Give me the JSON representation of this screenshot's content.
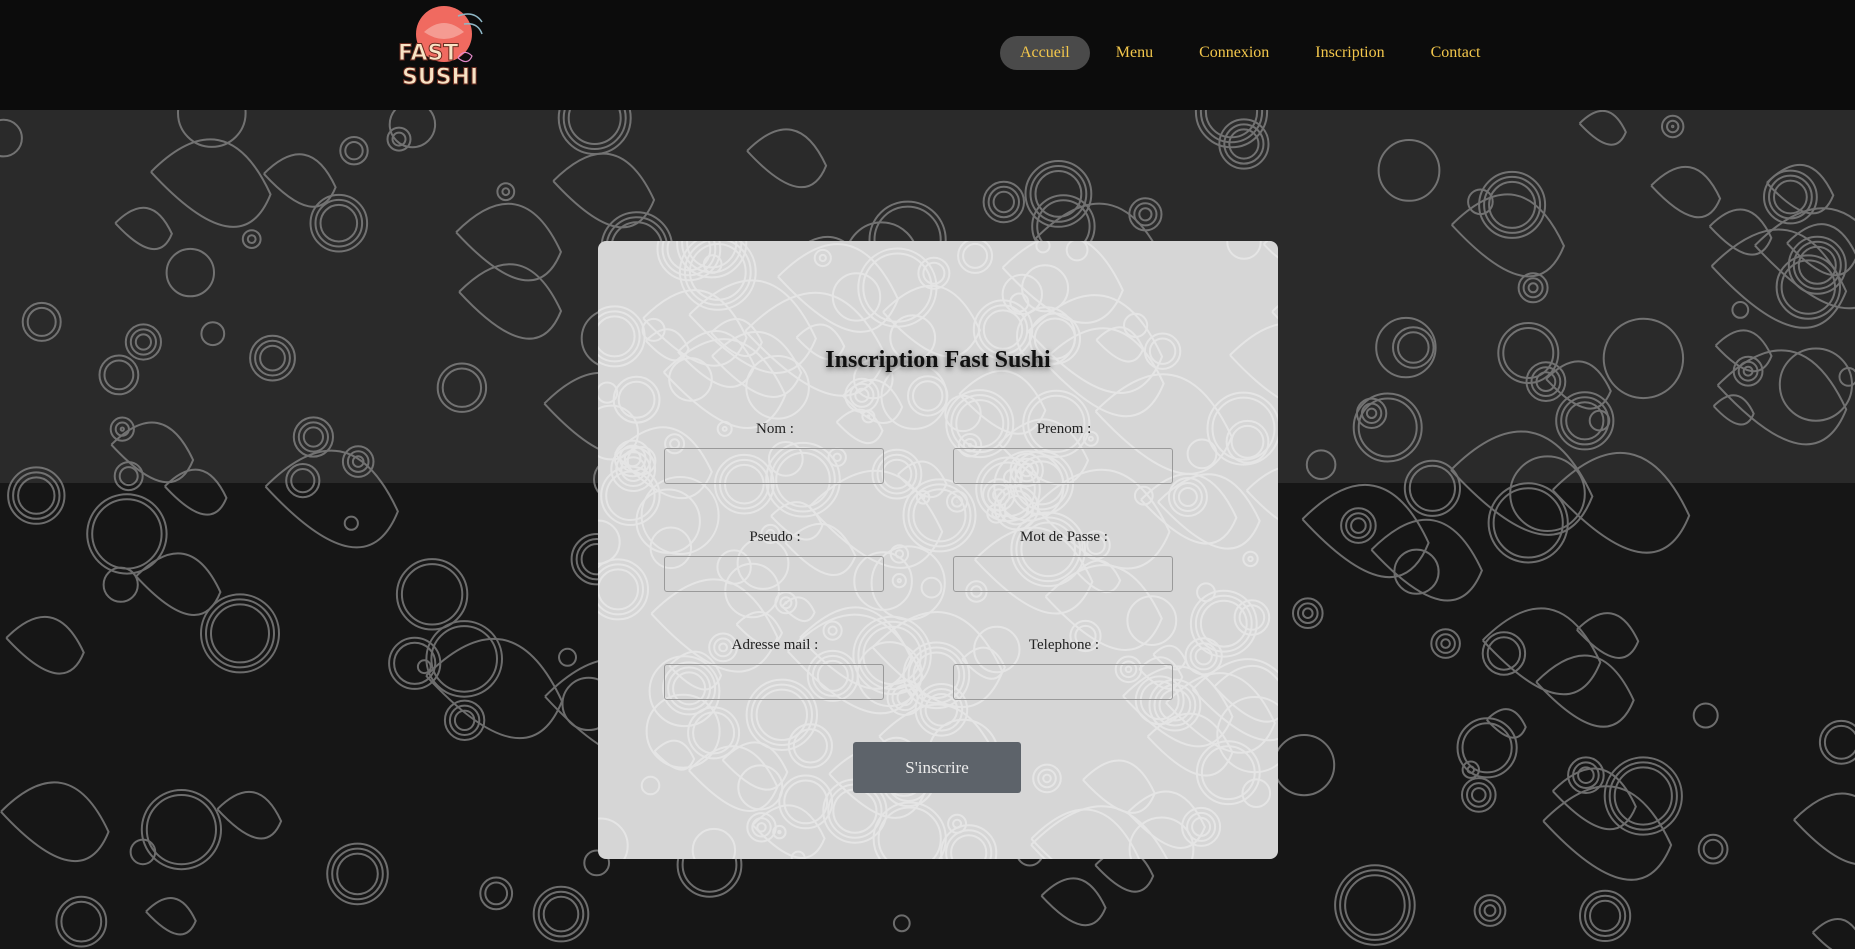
{
  "brand": {
    "logo_text_top": "FAST",
    "logo_text_bottom": "SUSHI",
    "logo_accent": "#f06a60",
    "logo_text_color": "#f7e3c5"
  },
  "nav": {
    "items": [
      {
        "label": "Accueil",
        "active": true
      },
      {
        "label": "Menu",
        "active": false
      },
      {
        "label": "Connexion",
        "active": false
      },
      {
        "label": "Inscription",
        "active": false
      },
      {
        "label": "Contact",
        "active": false
      }
    ],
    "link_color": "#f3c74c"
  },
  "form": {
    "title": "Inscription Fast Sushi",
    "fields": {
      "nom": {
        "label": "Nom :",
        "value": ""
      },
      "prenom": {
        "label": "Prenom :",
        "value": ""
      },
      "pseudo": {
        "label": "Pseudo :",
        "value": ""
      },
      "mot_de_passe": {
        "label": "Mot de Passe :",
        "value": ""
      },
      "adresse_mail": {
        "label": "Adresse mail :",
        "value": ""
      },
      "telephone": {
        "label": "Telephone :",
        "value": ""
      }
    },
    "submit_label": "S'inscrire"
  },
  "colors": {
    "header_bg": "#0c0c0c",
    "card_bg": "#d6d6d6",
    "button_bg": "#5d636a"
  }
}
